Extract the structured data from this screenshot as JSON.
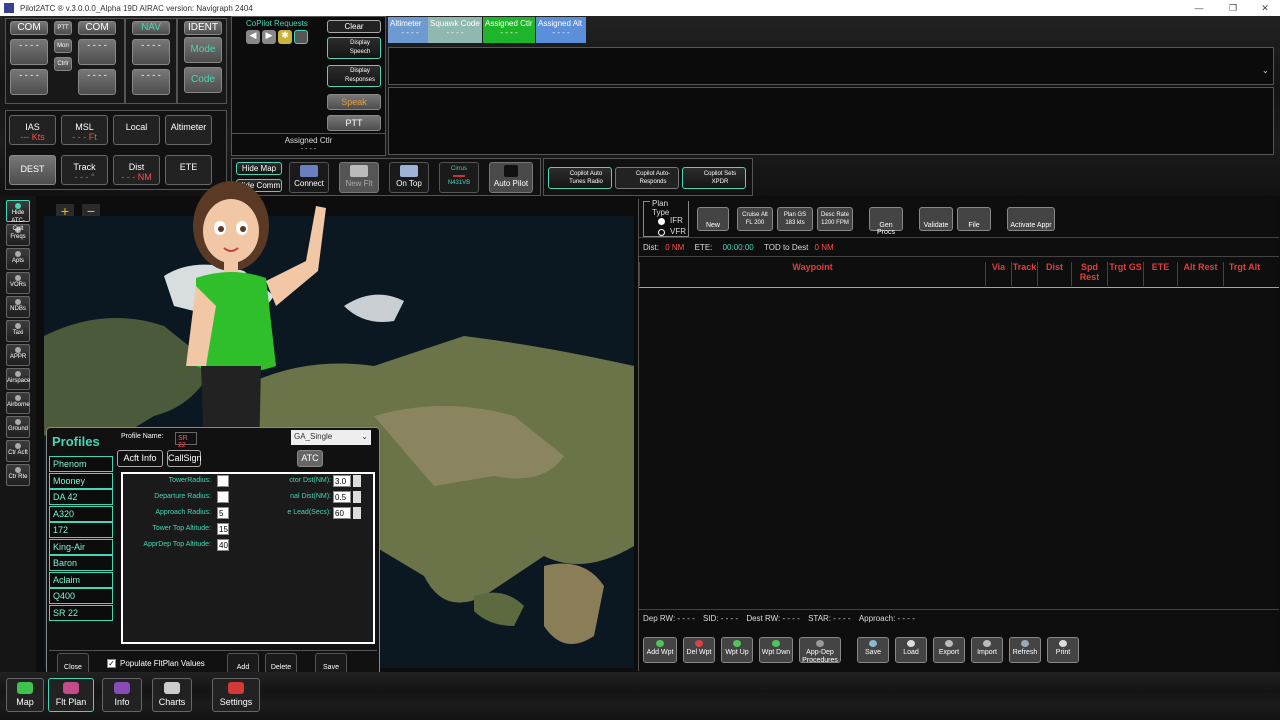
{
  "title": "Pilot2ATC ® v.3.0.0.0_Alpha 19D   AIRAC version: Navigraph 2404",
  "radios": {
    "com1": "COM",
    "pttmon": "PTT",
    "mon": "Mon",
    "ctrl": "Ctrlr",
    "com2": "COM",
    "nav": "NAV",
    "ident": "IDENT",
    "mode": "Mode",
    "code": "Code",
    "dashes": "- - - -"
  },
  "copilot": {
    "header": "CoPilot Requests",
    "clear": "Clear",
    "display_speech": "Display Speech",
    "display_responses": "Display Responses",
    "speak": "Speak",
    "ptt": "PTT",
    "assigned_ctlr": "Assigned Ctlr",
    "assigned_dash": "- - - -"
  },
  "assigned": {
    "altimeter": "Altimeter",
    "squawk": "Squawk Code",
    "ctlr": "Assigned Ctlr",
    "alt": "Assigned Alt",
    "dash": "- - - -"
  },
  "instruments": {
    "ias": "IAS",
    "ias_val": "--- Kts",
    "msl": "MSL",
    "msl_val": "- - - Ft",
    "local": "Local",
    "altimeter": "Altimeter",
    "dest": "DEST",
    "track": "Track",
    "track_val": "- - - °",
    "dist": "Dist",
    "dist_val": "- - - NM",
    "ete": "ETE"
  },
  "toolbar": {
    "hide_map": "Hide Map",
    "hide_comm": "Hide Comm",
    "connect": "Connect",
    "new_flt": "New Flt",
    "on_top": "On Top",
    "cirrus": "Cirrus",
    "cirrus_reg": "N431VB",
    "auto_pilot": "Auto Pilot",
    "copilot_tunes": "Copilot Auto Tunes Radio",
    "copilot_responds": "Copilot Auto-Responds",
    "copilot_xpdr": "Copilot Sets XPDR"
  },
  "sidebar": [
    {
      "label": "Hide ATC-Cplt"
    },
    {
      "label": "Freqs"
    },
    {
      "label": "Apts"
    },
    {
      "label": "VORs"
    },
    {
      "label": "NDBs"
    },
    {
      "label": "Taxi"
    },
    {
      "label": "APPR"
    },
    {
      "label": "Airspace"
    },
    {
      "label": "Airborne"
    },
    {
      "label": "Ground"
    },
    {
      "label": "Ctr Acft"
    },
    {
      "label": "Ctr Rte"
    }
  ],
  "map": {
    "zoom_in": "+",
    "zoom_out": "−"
  },
  "profiles": {
    "title": "Profiles",
    "items": [
      "Phenom",
      "Mooney",
      "DA 42",
      "A320",
      "172",
      "King-Air",
      "Baron",
      "Aclaim",
      "Q400",
      "SR 22"
    ],
    "profile_name_label": "Profile Name:",
    "profile_name": "SR 22",
    "type": "GA_Single",
    "tabs": [
      "Acft Info",
      "CallSign",
      "ATC"
    ],
    "fields_left": [
      "TowerRadius:",
      "Departure Radius:",
      "Approach Radius:",
      "Tower Top Altitude:",
      "ApprDep Top Altitude:"
    ],
    "left_vals": [
      "",
      "",
      "5",
      "15",
      "40"
    ],
    "fields_right": [
      "ctor Dst(NM):",
      "nal Dist(NM):",
      "e Lead(Secs):"
    ],
    "right_vals": [
      "3.0",
      "0.5",
      "60"
    ],
    "close": "Close",
    "populate": "Populate FltPlan Values",
    "add": "Add",
    "delete": "Delete",
    "save": "Save"
  },
  "plan": {
    "plan_type": "Plan Type",
    "ifr": "IFR",
    "vfr": "VFR",
    "new": "New",
    "cruise_alt": "Cruise Alt",
    "cruise_val": "FL 200",
    "plan_gs": "Plan GS",
    "plan_gs_val": "183 kts",
    "desc_rate": "Desc Rate",
    "desc_val": "1200 FPM",
    "gen_procs": "Gen Procs",
    "validate": "Validate",
    "file": "File",
    "activate": "Activate Appr",
    "dist_label": "Dist:",
    "dist_val": "0 NM",
    "ete_label": "ETE:",
    "ete_val": "00:00:00",
    "tod_label": "TOD to Dest",
    "tod_val": "0 NM",
    "columns": [
      "Waypoint",
      "Via",
      "Track",
      "Dist",
      "Spd Rest",
      "Trgt GS",
      "ETE",
      "Alt Rest",
      "Trgt Alt"
    ],
    "dep_rw": "Dep RW:",
    "sid": "SID:",
    "dest_rw": "Dest RW:",
    "star": "STAR:",
    "approach": "Approach:",
    "dash": "- - - -"
  },
  "plan_buttons": [
    "Add Wpt",
    "Del Wpt",
    "Wpt Up",
    "Wpt Dwn",
    "App-Dep Procedures",
    "Save",
    "Load",
    "Export",
    "Import",
    "Refresh",
    "Print"
  ],
  "bottom_tabs": [
    "Map",
    "Flt Plan",
    "Info",
    "Charts",
    "Settings"
  ]
}
